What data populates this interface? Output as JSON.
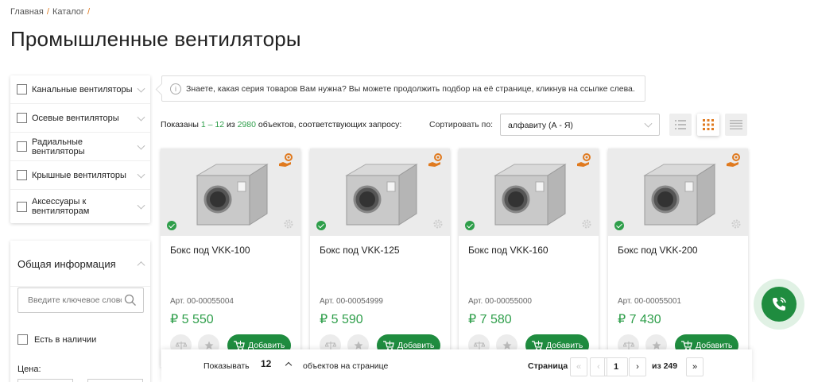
{
  "breadcrumb": {
    "items": [
      "Главная",
      "Каталог"
    ],
    "separator": "/"
  },
  "page_title": "Промышленные вентиляторы",
  "categories": [
    {
      "label": "Канальные вентиляторы"
    },
    {
      "label": "Осевые вентиляторы"
    },
    {
      "label": "Радиальные вентиляторы"
    },
    {
      "label": "Крышные вентиляторы"
    },
    {
      "label": "Аксессуары к вентиляторам"
    }
  ],
  "filters": {
    "general_title": "Общая информация",
    "search_placeholder": "Введите ключевое слово",
    "in_stock_label": "Есть в наличии",
    "price_label": "Цена:"
  },
  "tip": {
    "icon": "i",
    "text": "Знаете, какая серия товаров Вам нужна? Вы можете продолжить подбор на её странице, кликнув на ссылке слева."
  },
  "results": {
    "prefix": "Показаны",
    "range": "1 – 12",
    "of": "из",
    "total": "2980",
    "suffix": "объектов, соответствующих запросу:"
  },
  "sort": {
    "label": "Сортировать по:",
    "value": "алфавиту (А - Я)"
  },
  "view_modes": [
    "list-icon",
    "grid-icon",
    "table-icon"
  ],
  "products": [
    {
      "name": "Бокс под VKK-100",
      "art": "Арт. 00-00055004",
      "price": "₽ 5 550",
      "add_label": "Добавить"
    },
    {
      "name": "Бокс под VKK-125",
      "art": "Арт. 00-00054999",
      "price": "₽ 5 590",
      "add_label": "Добавить"
    },
    {
      "name": "Бокс под VKK-160",
      "art": "Арт. 00-00055000",
      "price": "₽ 7 580",
      "add_label": "Добавить"
    },
    {
      "name": "Бокс под VKK-200",
      "art": "Арт. 00-00055001",
      "price": "₽ 7 430",
      "add_label": "Добавить"
    }
  ],
  "pager": {
    "show_label": "Показывать",
    "per_page": "12",
    "per_page_suffix": "объектов на странице",
    "page_label": "Страница",
    "first": "«",
    "prev": "‹",
    "current": "1",
    "next": "›",
    "of_pages": "из 249",
    "last": "»"
  },
  "colors": {
    "accent_green": "#2e9e4a",
    "button_green": "#1f8c3f",
    "orange": "#e07a1f"
  }
}
